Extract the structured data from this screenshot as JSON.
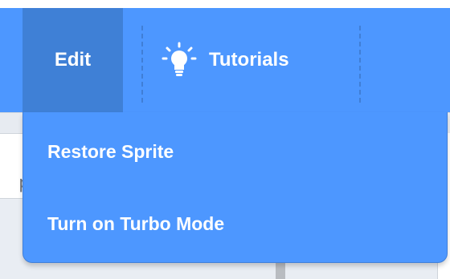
{
  "menubar": {
    "edit_label": "Edit",
    "tutorials_label": "Tutorials",
    "tutorials_icon": "lightbulb-icon"
  },
  "edit_menu": {
    "items": [
      {
        "label": "Restore Sprite"
      },
      {
        "label": "Turn on Turbo Mode"
      }
    ]
  },
  "background": {
    "partial_text": "p"
  },
  "colors": {
    "menubar": "#4d97ff",
    "menubar_active": "#3f80d6",
    "text": "#ffffff"
  }
}
